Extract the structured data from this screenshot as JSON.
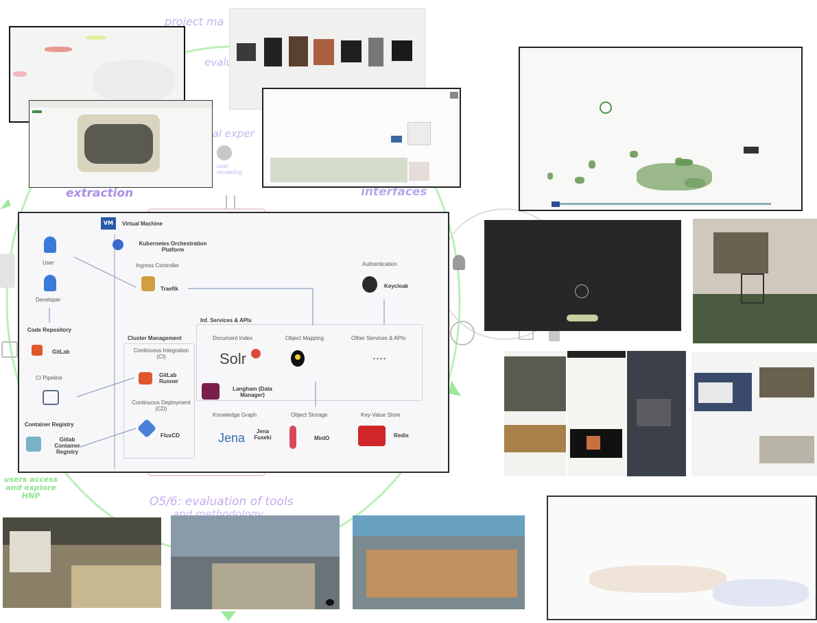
{
  "diagram": {
    "labels": {
      "project_management": "project ma",
      "evaluation": "evalu",
      "visual_experts": "ual exper",
      "extraction": "extraction",
      "interfaces": "interfaces",
      "user_modeling": "user modeling",
      "o56_line1": "O5/6: evaluation of tools",
      "o56_line2": "and methodology",
      "users_access": "users access and explore HNP"
    },
    "vm": {
      "badge": "VM",
      "title": "Virtual Machine",
      "k8s": "Kubernetes Orchestration Platform",
      "ingress": "Ingress Controller",
      "traefik": "Traefik",
      "user": "User",
      "developer": "Developer",
      "code_repo": "Code Repository",
      "gitlab": "GitLab",
      "ci_pipeline": "CI Pipeline",
      "container_registry": "Container Registry",
      "gitlab_registry": "Gitlab Container Registry",
      "cluster_mgmt": "Cluster Management",
      "ci": "Continuous Integration (CI)",
      "gitlab_runner": "GitLab Runner",
      "cd": "Continuous Deployment (CD)",
      "fluxcd": "FluxCD",
      "infra_services": "Inf. Services & APIs",
      "doc_index": "Document Index",
      "solr": "Solr",
      "langham": "Langham (Data Manager)",
      "knowledge_graph": "Knowledge Graph",
      "jena": "Jena",
      "fuseki": "Jena Fuseki",
      "object_storage": "Object Storage",
      "minio": "MinIO",
      "object_mapping": "Object Mapping",
      "keyvalue": "Key-Value Store",
      "redis": "Redis",
      "other_services": "Other Services & APIs",
      "other_dots": "• • • •",
      "authentication": "Authentication",
      "keycloak": "Keycloak"
    }
  }
}
